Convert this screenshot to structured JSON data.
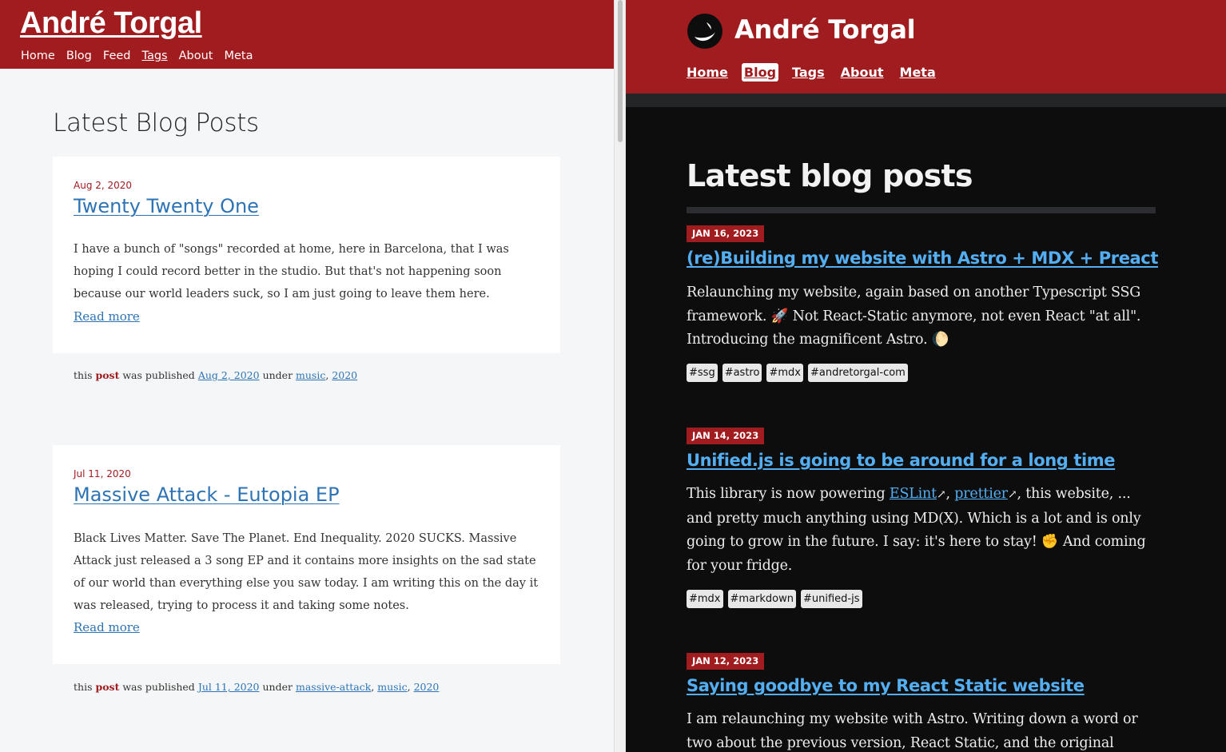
{
  "left": {
    "site_title": "André Torgal",
    "nav": [
      {
        "label": "Home"
      },
      {
        "label": "Blog"
      },
      {
        "label": "Feed"
      },
      {
        "label": "Tags"
      },
      {
        "label": "About"
      },
      {
        "label": "Meta"
      }
    ],
    "page_title": "Latest Blog Posts",
    "posts": [
      {
        "date": "Aug 2, 2020",
        "title": "Twenty Twenty One",
        "excerpt": "I have a bunch of \"songs\" recorded at home, here in Barcelona, that I was hoping I could record better in the studio. But that's not happening soon because our world leaders suck, so I am just going to leave them here.",
        "read_more": "Read more",
        "meta_prefix": "this",
        "meta_kind": "post",
        "meta_published": "was published",
        "meta_date": "Aug 2, 2020",
        "meta_under": "under",
        "tags": [
          "music",
          "2020"
        ]
      },
      {
        "date": "Jul 11, 2020",
        "title": "Massive Attack - Eutopia EP",
        "excerpt": "Black Lives Matter. Save The Planet. End Inequality. 2020 SUCKS. Massive Attack just released a 3 song EP and it contains more insights on the sad state of our world than everything else you saw today. I am writing this on the day it was released, trying to process it and taking some notes.",
        "read_more": "Read more",
        "meta_prefix": "this",
        "meta_kind": "post",
        "meta_published": "was published",
        "meta_date": "Jul 11, 2020",
        "meta_under": "under",
        "tags": [
          "massive-attack",
          "music",
          "2020"
        ]
      }
    ]
  },
  "right": {
    "site_title": "André Torgal",
    "nav": [
      {
        "label": "Home"
      },
      {
        "label": "Blog"
      },
      {
        "label": "Tags"
      },
      {
        "label": "About"
      },
      {
        "label": "Meta"
      }
    ],
    "active_nav": "Blog",
    "page_title": "Latest blog posts",
    "posts": [
      {
        "date": "JAN 16, 2023",
        "title": "(re)Building my website with Astro + MDX + Preact",
        "body_1": "Relaunching my website, again based on another Typescript SSG framework. 🚀 Not React-Static anymore, not even React \"at all\". Introducing the magnificent Astro. 🌔",
        "tags": [
          "#ssg",
          "#astro",
          "#mdx",
          "#andretorgal-com"
        ]
      },
      {
        "date": "JAN 14, 2023",
        "title": "Unified.js is going to be around for a long time",
        "body_1": "This library is now powering",
        "link_1": "ESLint",
        "sep": ",",
        "link_2": "prettier",
        "body_2": ", this website, ... and pretty much anything using MD(X). Which is a lot and is only going to grow in the future. I say: it's here to stay! ✊ And coming for your fridge.",
        "tags": [
          "#mdx",
          "#markdown",
          "#unified-js"
        ]
      },
      {
        "date": "JAN 12, 2023",
        "title": "Saying goodbye to my React Static website",
        "body_1": "I am relaunching my website with Astro. Writing down a word or two about the previous version, React Static, and the original"
      }
    ]
  },
  "colors": {
    "brand_red": "#a11c1f",
    "link_blue_light": "#2e74b5",
    "link_blue_dark": "#53aef2",
    "dark_bg": "#0d0d0e",
    "light_bg": "#f5f6f7"
  }
}
